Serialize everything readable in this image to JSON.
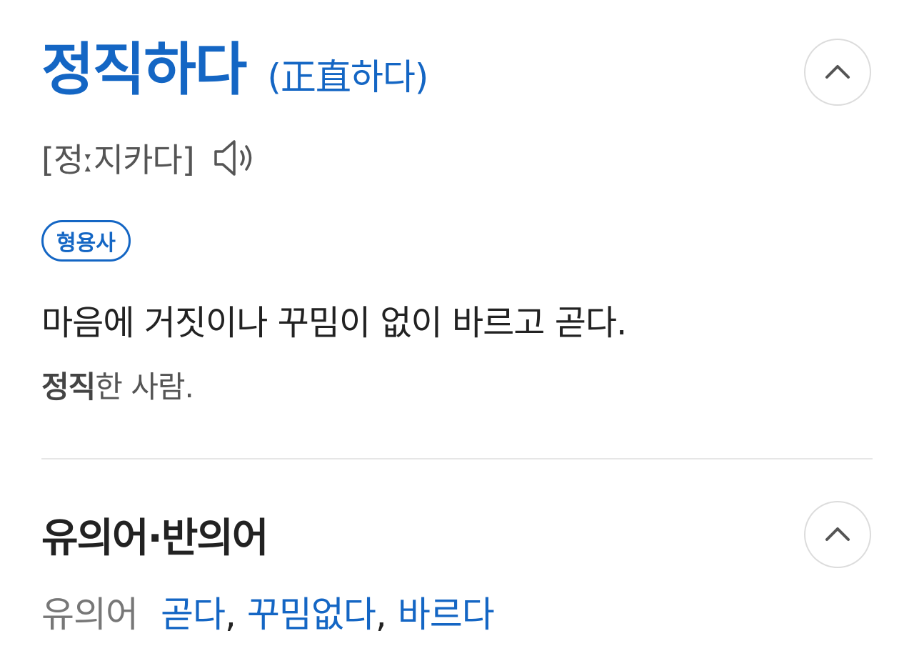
{
  "entry": {
    "headword": "정직하다",
    "hanja": "(正直하다)",
    "pronunciation": "[정ː지카다]",
    "speaker_icon": "speaker-icon",
    "part_of_speech": "형용사",
    "definition": "마음에 거짓이나 꾸밈이 없이 바르고 곧다.",
    "example_bold": "정직",
    "example_rest": "한 사람."
  },
  "synonyms_section": {
    "title": "유의어·반의어",
    "label": "유의어",
    "items": [
      "곧다",
      "꾸밈없다",
      "바르다"
    ],
    "separator": ","
  },
  "icons": {
    "collapse": "chevron-up-icon"
  },
  "colors": {
    "accent": "#1466c4",
    "text": "#222222",
    "muted": "#777777"
  }
}
